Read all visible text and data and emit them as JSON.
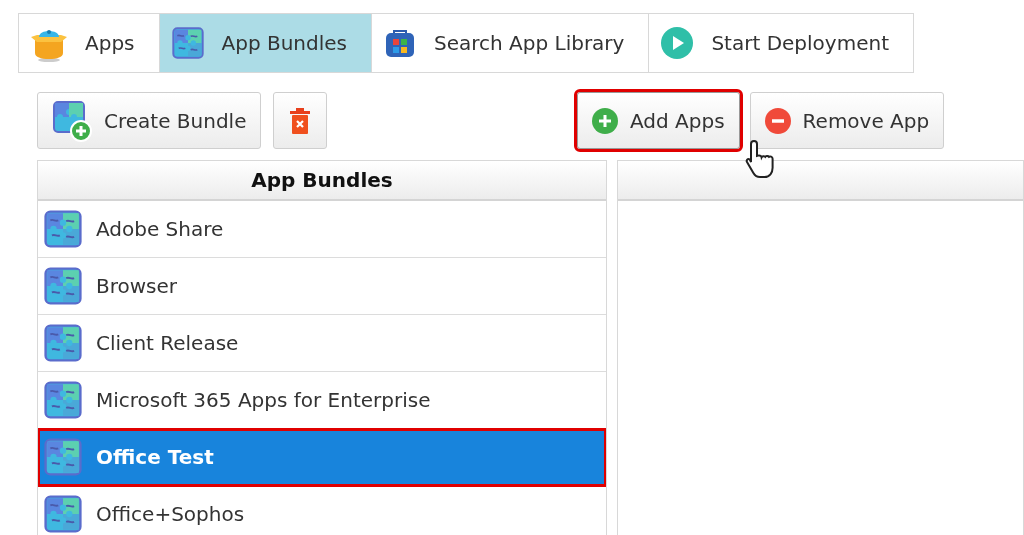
{
  "tabs": [
    {
      "label": "Apps",
      "kind": "box",
      "selected": false
    },
    {
      "label": "App Bundles",
      "kind": "puzzle",
      "selected": true
    },
    {
      "label": "Search App Library",
      "kind": "store",
      "selected": false
    },
    {
      "label": "Start Deployment",
      "kind": "play",
      "selected": false
    }
  ],
  "bundle_toolbar": [
    {
      "label": "Create Bundle",
      "kind": "create",
      "highlighted": false
    },
    {
      "kind": "delete",
      "highlighted": false
    }
  ],
  "app_toolbar": [
    {
      "label": "Add Apps",
      "kind": "add",
      "highlighted": true
    },
    {
      "label": "Remove App",
      "kind": "remove",
      "highlighted": false
    }
  ],
  "bundle_list": {
    "header": "App Bundles",
    "items": [
      {
        "label": "Adobe Share",
        "selected": false
      },
      {
        "label": "Browser",
        "selected": false
      },
      {
        "label": "Client Release",
        "selected": false
      },
      {
        "label": "Microsoft 365 Apps for Enterprise",
        "selected": false
      },
      {
        "label": "Office Test",
        "selected": true
      },
      {
        "label": "Office+Sophos",
        "selected": false
      }
    ]
  }
}
